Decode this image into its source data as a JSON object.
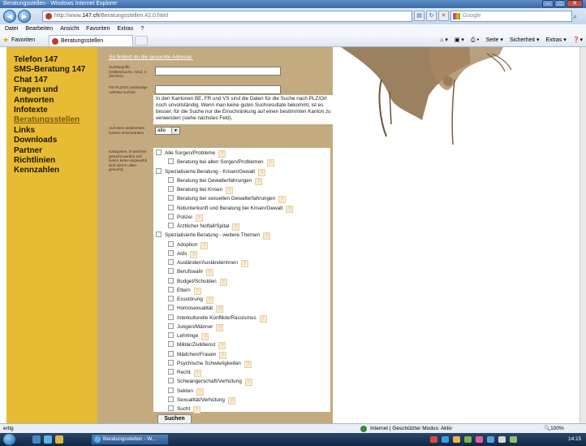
{
  "window": {
    "title": "Beratungsstellen - Windows Internet Explorer"
  },
  "addressbar": {
    "url_prefix": "http://www.",
    "url_domain": "147.ch",
    "url_path": "/Beratungsstellen.42.0.html"
  },
  "search": {
    "placeholder": "Google"
  },
  "menu": [
    "Datei",
    "Bearbeiten",
    "Ansicht",
    "Favoriten",
    "Extras",
    "?"
  ],
  "favorites": {
    "label": "Favoriten",
    "tab_title": "Beratungsstellen"
  },
  "commandbar": {
    "seite": "Seite ▾",
    "sicherheit": "Sicherheit ▾",
    "extras": "Extras ▾"
  },
  "sidebar": {
    "items": [
      {
        "label": "Telefon 147"
      },
      {
        "label": "SMS-Beratung 147"
      },
      {
        "label": "Chat 147"
      },
      {
        "label": "Fragen und Antworten"
      },
      {
        "label": "Infotexte"
      },
      {
        "label": "Beratungsstellen"
      },
      {
        "label": "Links"
      },
      {
        "label": "Downloads"
      },
      {
        "label": "Partner"
      },
      {
        "label": "Richtlinien"
      },
      {
        "label": "Kennzahlen"
      }
    ],
    "active_index": 5
  },
  "form": {
    "intro_link": "So findest du die gesuchte Adresse:",
    "keywords_label": "Suchbegriffe (Volltextsuche, mind. 4 Zeichen)",
    "plz_label": "Für PLZ/Ort zuständige Adresse suchen",
    "plz_hint": "In den Kantonen BE, FR und VS sind die Daten für die Suche nach PLZ/Ort noch unvollständig. Wenn man keine guten Suchresultate bekommt, ist es besser, für die Suche nur die Einschränkung auf einen bestimmten Kanton zu verwenden (siehe nächstes Feld).",
    "canton_label": "Auf einen bestimmten Kanton einschränken",
    "canton_value": "alle",
    "categories_label": "Kategorien, in welchen gesucht werden soll (wenn keine angewählt sind wird in allen gesucht)",
    "categories": [
      {
        "label": "Alle Sorgen/Probleme",
        "level": 0
      },
      {
        "label": "Beratung bei allen Sorgen/Problemen",
        "level": 1
      },
      {
        "label": "Spezialisierte Beratung - Krisen/Gewalt",
        "level": 0
      },
      {
        "label": "Beratung bei Gewalterfahrungen",
        "level": 1
      },
      {
        "label": "Beratung bei Krisen",
        "level": 1
      },
      {
        "label": "Beratung bei sexuellen Gewalterfahrungen",
        "level": 1
      },
      {
        "label": "Notunterkunft und Beratung bei Krisen/Gewalt",
        "level": 1
      },
      {
        "label": "Polizei",
        "level": 1
      },
      {
        "label": "Ärztlicher Notfall/Spital",
        "level": 1
      },
      {
        "label": "Spezialisierte Beratung - weitere Themen",
        "level": 0
      },
      {
        "label": "Adoption",
        "level": 1
      },
      {
        "label": "Aids",
        "level": 1
      },
      {
        "label": "Ausländer/Ausländerinnen",
        "level": 1
      },
      {
        "label": "Berufswahl",
        "level": 1
      },
      {
        "label": "Budget/Schulden",
        "level": 1
      },
      {
        "label": "Eltern",
        "level": 1
      },
      {
        "label": "Essstörung",
        "level": 1
      },
      {
        "label": "Homosexualität",
        "level": 1
      },
      {
        "label": "Interkulturelle Konflikte/Rassismus",
        "level": 1
      },
      {
        "label": "Jungen/Männer",
        "level": 1
      },
      {
        "label": "Lehrlinge",
        "level": 1
      },
      {
        "label": "Militär/Zivildienst",
        "level": 1
      },
      {
        "label": "Mädchen/Frauen",
        "level": 1
      },
      {
        "label": "Psychische Schwierigkeiten",
        "level": 1
      },
      {
        "label": "Recht",
        "level": 1
      },
      {
        "label": "Schwangerschaft/Verhütung",
        "level": 1
      },
      {
        "label": "Sekten",
        "level": 1
      },
      {
        "label": "Sexualität/Verhütung",
        "level": 1
      },
      {
        "label": "Sucht",
        "level": 1
      }
    ],
    "help_glyph": "?",
    "submit_label": "Suchen"
  },
  "statusbar": {
    "left": "ertig",
    "zone": "Internet | Geschützter Modus: Aktiv",
    "zoom": "100%"
  },
  "taskbar": {
    "item": "Beratungsstellen - W...",
    "clock": "14:15"
  },
  "colors": {
    "sidebar": "#e7bb33",
    "form_bg": "#c4aa7f",
    "link": "#ffffff"
  }
}
